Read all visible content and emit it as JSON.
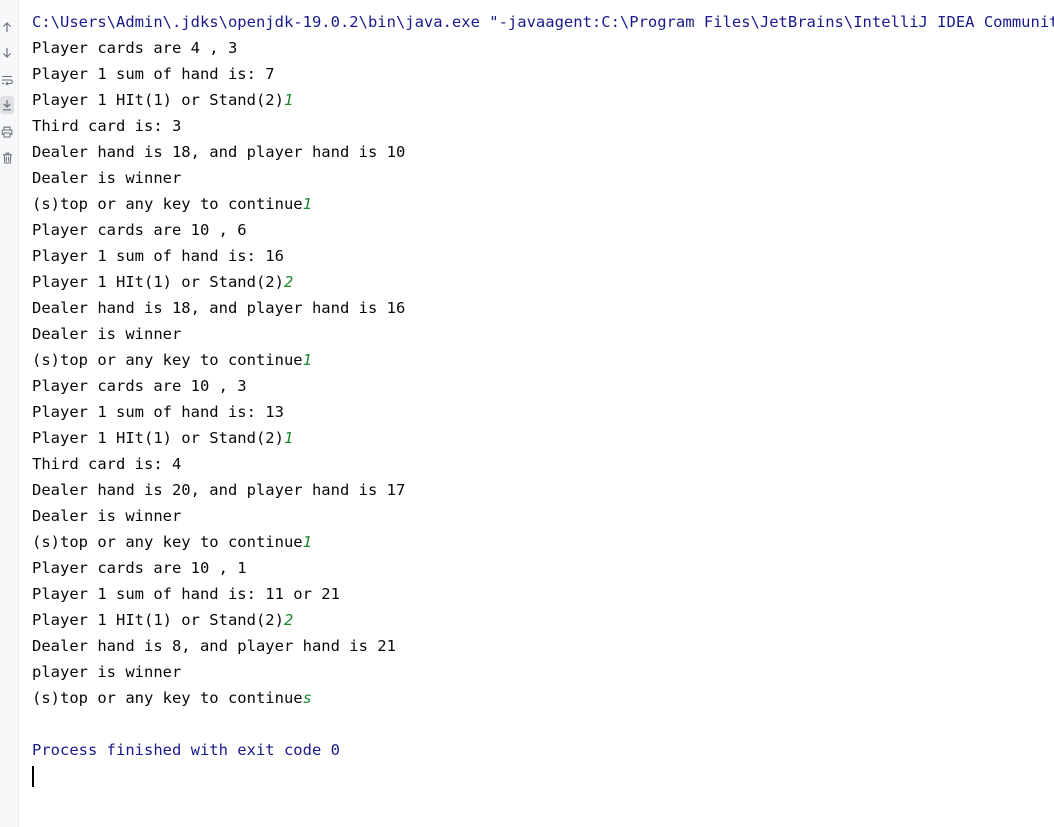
{
  "colors": {
    "stdout": "#080808",
    "system": "#1a1a8c",
    "user_input": "#1b8a2f",
    "gutter_bg": "#f7f8fa"
  },
  "gutter_icons": [
    "arrow-up-icon",
    "arrow-down-icon",
    "soft-wrap-icon",
    "scroll-to-end-icon",
    "print-icon",
    "trash-icon"
  ],
  "console": {
    "command_line": "C:\\Users\\Admin\\.jdks\\openjdk-19.0.2\\bin\\java.exe \"-javaagent:C:\\Program Files\\JetBrains\\IntelliJ IDEA Community Edition",
    "lines": [
      {
        "text": "Player cards are 4 , 3",
        "input": ""
      },
      {
        "text": "Player 1 sum of hand is: 7",
        "input": ""
      },
      {
        "text": "Player 1 HIt(1) or Stand(2)",
        "input": "1"
      },
      {
        "text": "Third card is: 3",
        "input": ""
      },
      {
        "text": "Dealer hand is 18, and player hand is 10",
        "input": ""
      },
      {
        "text": "Dealer is winner",
        "input": ""
      },
      {
        "text": "(s)top or any key to continue",
        "input": "1"
      },
      {
        "text": "Player cards are 10 , 6",
        "input": ""
      },
      {
        "text": "Player 1 sum of hand is: 16",
        "input": ""
      },
      {
        "text": "Player 1 HIt(1) or Stand(2)",
        "input": "2"
      },
      {
        "text": "Dealer hand is 18, and player hand is 16",
        "input": ""
      },
      {
        "text": "Dealer is winner",
        "input": ""
      },
      {
        "text": "(s)top or any key to continue",
        "input": "1"
      },
      {
        "text": "Player cards are 10 , 3",
        "input": ""
      },
      {
        "text": "Player 1 sum of hand is: 13",
        "input": ""
      },
      {
        "text": "Player 1 HIt(1) or Stand(2)",
        "input": "1"
      },
      {
        "text": "Third card is: 4",
        "input": ""
      },
      {
        "text": "Dealer hand is 20, and player hand is 17",
        "input": ""
      },
      {
        "text": "Dealer is winner",
        "input": ""
      },
      {
        "text": "(s)top or any key to continue",
        "input": "1"
      },
      {
        "text": "Player cards are 10 , 1",
        "input": ""
      },
      {
        "text": "Player 1 sum of hand is: 11 or 21",
        "input": ""
      },
      {
        "text": "Player 1 HIt(1) or Stand(2)",
        "input": "2"
      },
      {
        "text": "Dealer hand is 8, and player hand is 21",
        "input": ""
      },
      {
        "text": "player is winner",
        "input": ""
      },
      {
        "text": "(s)top or any key to continue",
        "input": "s"
      }
    ],
    "exit_message": "Process finished with exit code 0"
  }
}
